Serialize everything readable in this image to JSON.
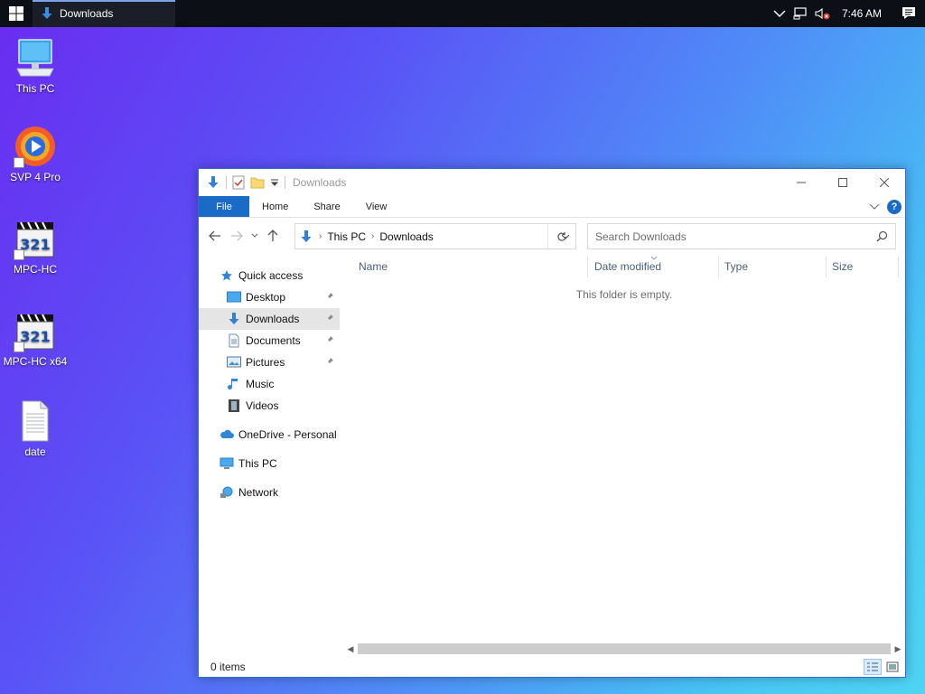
{
  "taskbar": {
    "window_title": "Downloads",
    "clock": "7:46 AM",
    "icons": [
      "windows-logo-icon",
      "download-arrow-icon",
      "chevron-up-icon",
      "network-icon",
      "volume-muted-icon",
      "notification-icon"
    ]
  },
  "desktop": {
    "icons": [
      {
        "label": "This PC",
        "icon": "computer-icon"
      },
      {
        "label": "SVP 4 Pro",
        "icon": "svp-icon"
      },
      {
        "label": "MPC-HC",
        "icon": "mpc-hc-icon"
      },
      {
        "label": "MPC-HC x64",
        "icon": "mpc-hc-icon"
      },
      {
        "label": "date",
        "icon": "text-document-icon"
      }
    ]
  },
  "explorer": {
    "title": "Downloads",
    "ribbon_tabs": [
      "File",
      "Home",
      "Share",
      "View"
    ],
    "breadcrumb": [
      "This PC",
      "Downloads"
    ],
    "search_placeholder": "Search Downloads",
    "nav_pane": {
      "quick_access": "Quick access",
      "quick_items": [
        {
          "label": "Desktop",
          "pinned": true,
          "icon": "desktop-folder-icon"
        },
        {
          "label": "Downloads",
          "pinned": true,
          "icon": "downloads-folder-icon",
          "selected": true
        },
        {
          "label": "Documents",
          "pinned": true,
          "icon": "documents-folder-icon"
        },
        {
          "label": "Pictures",
          "pinned": true,
          "icon": "pictures-folder-icon"
        },
        {
          "label": "Music",
          "pinned": false,
          "icon": "music-icon"
        },
        {
          "label": "Videos",
          "pinned": false,
          "icon": "videos-folder-icon"
        }
      ],
      "onedrive": "OneDrive - Personal",
      "this_pc": "This PC",
      "network": "Network"
    },
    "columns": [
      "Name",
      "Date modified",
      "Type",
      "Size"
    ],
    "empty_message": "This folder is empty.",
    "status": "0 items"
  },
  "colors": {
    "accent": "#1a6ac8",
    "taskbar": "#0d0f17",
    "selection": "#e5e5e5"
  }
}
